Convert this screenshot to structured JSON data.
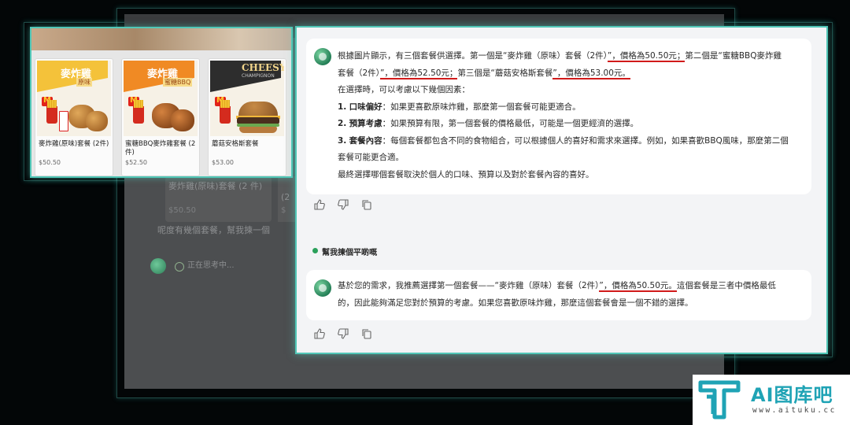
{
  "background_window": {
    "partial_item_name": "麥炸雞(原味)套餐 (2 件)",
    "partial_item_price": "$50.50",
    "partial_item2_name": "(2",
    "partial_item2_price": "$",
    "user_prompt": "呢度有幾個套餐，幫我揀一個",
    "thinking_label": "正在思考中..."
  },
  "menu": {
    "items": [
      {
        "banner": "麥炸雞",
        "banner_sub": "原味",
        "name": "麥炸雞(原味)套餐 (2件)",
        "price": "$50.50"
      },
      {
        "banner": "麥炸雞",
        "banner_sub": "蜜糖BBQ",
        "name": "蜜糖BBQ麥炸雞套餐 (2件)",
        "price": "$52.50"
      },
      {
        "banner": "CHEESY",
        "banner_sub": "CHAMPIGNON",
        "name": "蘑菇安格斯套餐",
        "price": "$53.00"
      }
    ]
  },
  "chat": {
    "ai_response_1": {
      "intro_a": "根據圖片顯示，有三個套餐供選擇。第一個是“麥炸雞（原味）套餐（2件）",
      "hl_1": "”，價格為50.50元；",
      "intro_b": "第二個是“蜜糖BBQ麥炸雞",
      "line2_a": "套餐（2件）",
      "hl_2": "”，價格為52.50元；",
      "line2_b": "第三個是“蘑菇安格斯套餐",
      "hl_3": "”，價格為53.00元。",
      "factors_intro": "在選擇時，可以考慮以下幾個因素：",
      "factors": [
        {
          "num": "1.",
          "title": "口味偏好",
          "text": "：如果更喜歡原味炸雞，那麼第一個套餐可能更適合。"
        },
        {
          "num": "2.",
          "title": "預算考慮",
          "text": "：如果預算有限，第一個套餐的價格最低，可能是一個更經濟的選擇。"
        },
        {
          "num": "3.",
          "title": "套餐內容",
          "text": "：每個套餐都包含不同的食物組合，可以根據個人的喜好和需求來選擇。例如，如果喜歡BBQ風味，那麼第二個"
        }
      ],
      "factor3_cont": "套餐可能更合適。",
      "conclusion": "最終選擇哪個套餐取決於個人的口味、預算以及對於套餐內容的喜好。"
    },
    "user_message": "幫我揀個平啲嘅",
    "ai_response_2": {
      "line1_a": "基於您的需求，我推薦選擇第一個套餐——“麥炸雞（原味）套餐（2件）",
      "hl": "”，價格為50.50元。",
      "line1_b": "這個套餐是三者中價格最低",
      "line2": "的，因此能夠滿足您對於預算的考慮。如果您喜歡原味炸雞，那麼這個套餐會是一個不錯的選擇。"
    },
    "actions": [
      "thumbs-up",
      "thumbs-down",
      "copy"
    ]
  },
  "watermark": {
    "title": "AI图库吧",
    "url": "www.aituku.cc"
  },
  "colors": {
    "accent_frame": "#51c7b7",
    "highlight_underline": "#d11a1a",
    "logo": "#1fa3b5"
  }
}
